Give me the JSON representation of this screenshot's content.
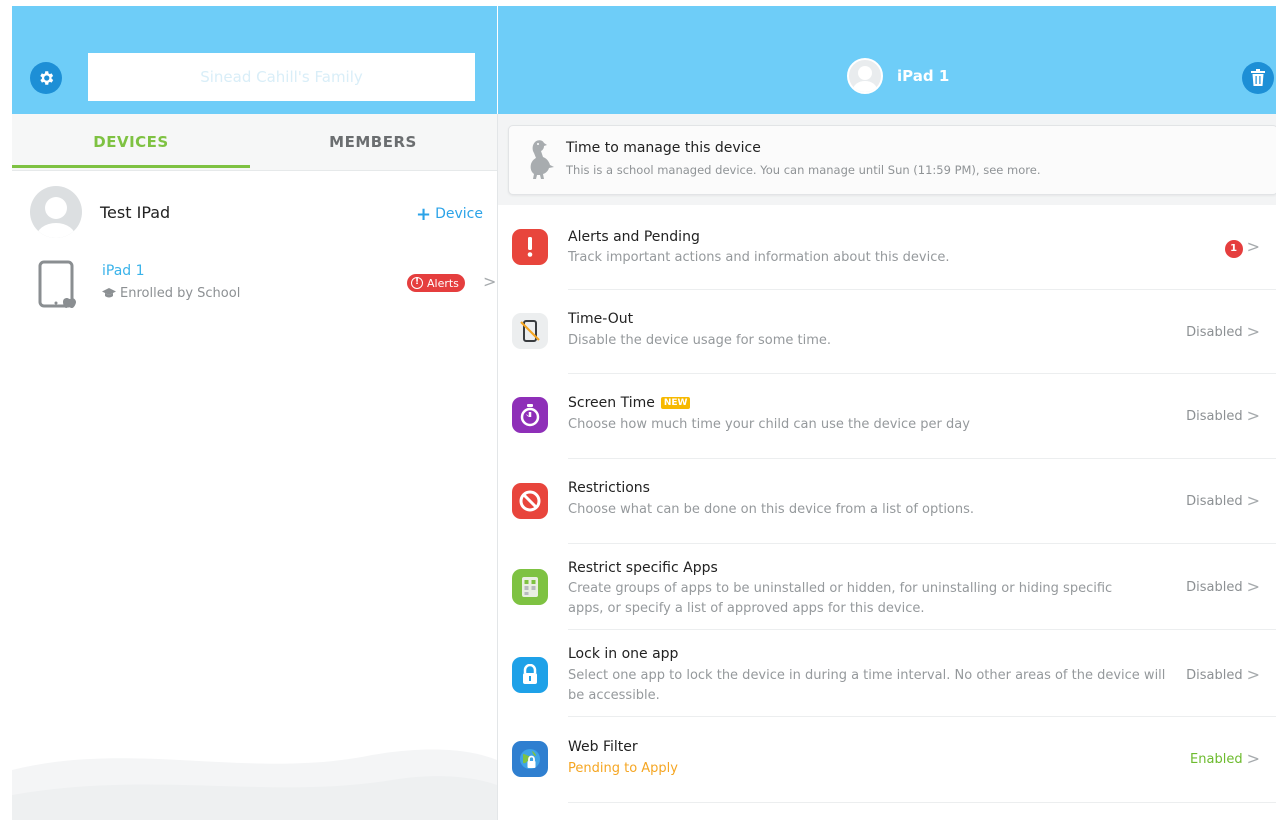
{
  "header": {
    "family_name": "Sinead Cahill's Family",
    "device_title": "iPad 1"
  },
  "tabs": {
    "devices": "DEVICES",
    "members": "MEMBERS"
  },
  "member": {
    "name": "Test IPad",
    "add_device_plus": "+",
    "add_device_label": "Device"
  },
  "device": {
    "name": "iPad 1",
    "enrolled": "Enrolled by School",
    "alerts_label": "Alerts",
    "alerts_mark": "!",
    "chevron": ">"
  },
  "manage_card": {
    "title": "Time to manage this device",
    "subtitle": "This is a school managed device. You can manage until Sun (11:59 PM), see more."
  },
  "items": [
    {
      "title": "Alerts and Pending",
      "subtitle": "Track important actions and information about this device.",
      "status": "",
      "badge": "1",
      "icon": "alert-icon",
      "color": "#e8453c"
    },
    {
      "title": "Time-Out",
      "subtitle": "Disable the device usage for some time.",
      "status": "Disabled",
      "icon": "timeout-icon",
      "color": "#eceeef"
    },
    {
      "title": "Screen Time",
      "new_badge": "NEW",
      "subtitle": "Choose how much time your child can use the device per day",
      "status": "Disabled",
      "icon": "stopwatch-icon",
      "color": "#8e2fb8"
    },
    {
      "title": "Restrictions",
      "subtitle": "Choose what can be done on this device from a list of options.",
      "status": "Disabled",
      "icon": "prohibited-icon",
      "color": "#e8453c"
    },
    {
      "title": "Restrict specific Apps",
      "subtitle": "Create groups of apps to be uninstalled or hidden, for uninstalling or hiding specific apps, or specify a list of approved apps for this device.",
      "status": "Disabled",
      "icon": "app-grid-icon",
      "color": "#7ec242"
    },
    {
      "title": "Lock in one app",
      "subtitle": "Select one app to lock the device in during a time interval. No other areas of the device will be accessible.",
      "status": "Disabled",
      "icon": "lock-icon",
      "color": "#1ea1e8"
    },
    {
      "title": "Web Filter",
      "subtitle": "Pending to Apply",
      "status": "Enabled",
      "icon": "globe-lock-icon",
      "color": "#2f7fd0"
    }
  ],
  "colors": {
    "header_bg": "#6ecdf8",
    "accent_green": "#7ec242",
    "accent_blue": "#2ba3e8",
    "alert_red": "#e53e3e",
    "pending_orange": "#f5a623"
  }
}
